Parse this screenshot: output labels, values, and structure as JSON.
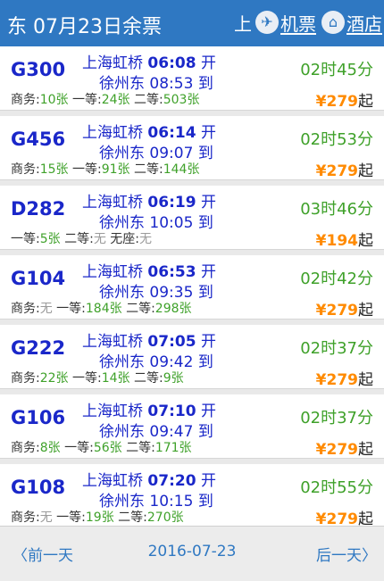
{
  "header": {
    "title": "东 07月23日余票",
    "shang": "上",
    "flight_label": "机票",
    "hotel_label": "酒店"
  },
  "trains": [
    {
      "no": "G300",
      "dep_station": "上海虹桥",
      "dep_time": "06:08",
      "dep_word": "开",
      "arr_station": "徐州东",
      "arr_time": "08:53",
      "arr_word": "到",
      "duration": "02时45分",
      "seats": [
        {
          "label": "商务:",
          "value": "10张"
        },
        {
          "label": "一等:",
          "value": "24张"
        },
        {
          "label": "二等:",
          "value": "503张"
        }
      ],
      "price": "279",
      "price_suffix": "起"
    },
    {
      "no": "G456",
      "dep_station": "上海虹桥",
      "dep_time": "06:14",
      "dep_word": "开",
      "arr_station": "徐州东",
      "arr_time": "09:07",
      "arr_word": "到",
      "duration": "02时53分",
      "seats": [
        {
          "label": "商务:",
          "value": "15张"
        },
        {
          "label": "一等:",
          "value": "91张"
        },
        {
          "label": "二等:",
          "value": "144张"
        }
      ],
      "price": "279",
      "price_suffix": "起"
    },
    {
      "no": "D282",
      "dep_station": "上海虹桥",
      "dep_time": "06:19",
      "dep_word": "开",
      "arr_station": "徐州东",
      "arr_time": "10:05",
      "arr_word": "到",
      "duration": "03时46分",
      "seats": [
        {
          "label": "一等:",
          "value": "5张"
        },
        {
          "label": "二等:",
          "value": "无"
        },
        {
          "label": "无座:",
          "value": "无"
        }
      ],
      "price": "194",
      "price_suffix": "起"
    },
    {
      "no": "G104",
      "dep_station": "上海虹桥",
      "dep_time": "06:53",
      "dep_word": "开",
      "arr_station": "徐州东",
      "arr_time": "09:35",
      "arr_word": "到",
      "duration": "02时42分",
      "seats": [
        {
          "label": "商务:",
          "value": "无"
        },
        {
          "label": "一等:",
          "value": "184张"
        },
        {
          "label": "二等:",
          "value": "298张"
        }
      ],
      "price": "279",
      "price_suffix": "起"
    },
    {
      "no": "G222",
      "dep_station": "上海虹桥",
      "dep_time": "07:05",
      "dep_word": "开",
      "arr_station": "徐州东",
      "arr_time": "09:42",
      "arr_word": "到",
      "duration": "02时37分",
      "seats": [
        {
          "label": "商务:",
          "value": "22张"
        },
        {
          "label": "一等:",
          "value": "14张"
        },
        {
          "label": "二等:",
          "value": "9张"
        }
      ],
      "price": "279",
      "price_suffix": "起"
    },
    {
      "no": "G106",
      "dep_station": "上海虹桥",
      "dep_time": "07:10",
      "dep_word": "开",
      "arr_station": "徐州东",
      "arr_time": "09:47",
      "arr_word": "到",
      "duration": "02时37分",
      "seats": [
        {
          "label": "商务:",
          "value": "8张"
        },
        {
          "label": "一等:",
          "value": "56张"
        },
        {
          "label": "二等:",
          "value": "171张"
        }
      ],
      "price": "279",
      "price_suffix": "起"
    },
    {
      "no": "G108",
      "dep_station": "上海虹桥",
      "dep_time": "07:20",
      "dep_word": "开",
      "arr_station": "徐州东",
      "arr_time": "10:15",
      "arr_word": "到",
      "duration": "02时55分",
      "seats": [
        {
          "label": "商务:",
          "value": "无"
        },
        {
          "label": "一等:",
          "value": "19张"
        },
        {
          "label": "二等:",
          "value": "270张"
        }
      ],
      "price": "279",
      "price_suffix": "起"
    }
  ],
  "footer": {
    "prev_label": "前一天",
    "date": "2016-07-23",
    "next_label": "后一天"
  },
  "colors": {
    "header_bg": "#2f78c2",
    "train_text": "#1a27c9",
    "duration": "#3fa12a",
    "price": "#ff8a00",
    "none": "#9a9a9a"
  },
  "icons": [
    "plane-icon",
    "hotel-icon",
    "chevron-left-icon",
    "chevron-right-icon"
  ]
}
